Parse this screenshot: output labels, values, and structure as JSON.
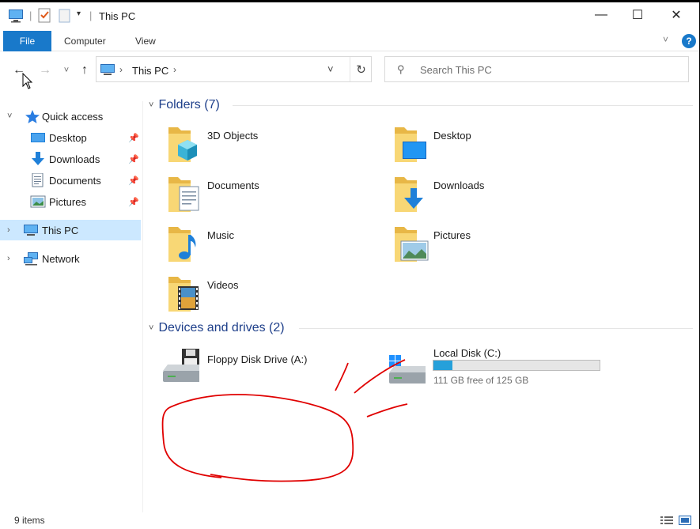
{
  "window": {
    "title": "This PC",
    "controls": {
      "minimize": "—",
      "maximize": "☐",
      "close": "✕"
    }
  },
  "ribbon": {
    "tabs": [
      "File",
      "Computer",
      "View"
    ],
    "help": "?"
  },
  "navigation": {
    "back": "←",
    "forward": "→",
    "recent": "˅",
    "up": "↑"
  },
  "address_bar": {
    "path": "This PC",
    "separator": "›",
    "dropdown": "˅",
    "refresh": "↻"
  },
  "search": {
    "placeholder": "Search This PC",
    "icon": "search-icon"
  },
  "sidebar": {
    "quick_access": {
      "label": "Quick access"
    },
    "quick_items": [
      {
        "label": "Desktop",
        "icon": "desktop-icon"
      },
      {
        "label": "Downloads",
        "icon": "downloads-icon"
      },
      {
        "label": "Documents",
        "icon": "documents-icon"
      },
      {
        "label": "Pictures",
        "icon": "pictures-icon"
      }
    ],
    "this_pc": {
      "label": "This PC"
    },
    "network": {
      "label": "Network"
    }
  },
  "content": {
    "folders_header": "Folders (7)",
    "folders": [
      {
        "name": "3D Objects",
        "icon": "3d-objects-folder-icon"
      },
      {
        "name": "Desktop",
        "icon": "desktop-folder-icon"
      },
      {
        "name": "Documents",
        "icon": "documents-folder-icon"
      },
      {
        "name": "Downloads",
        "icon": "downloads-folder-icon"
      },
      {
        "name": "Music",
        "icon": "music-folder-icon"
      },
      {
        "name": "Pictures",
        "icon": "pictures-folder-icon"
      },
      {
        "name": "Videos",
        "icon": "videos-folder-icon"
      }
    ],
    "drives_header": "Devices and drives (2)",
    "drives": [
      {
        "name": "Floppy Disk Drive (A:)",
        "icon": "floppy-drive-icon"
      },
      {
        "name": "Local Disk (C:)",
        "icon": "local-disk-icon",
        "free_text": "111 GB free of 125 GB",
        "used_fraction": 0.112
      }
    ]
  },
  "status": {
    "item_count": "9 items"
  },
  "colors": {
    "accent": "#1979ca",
    "selected": "#cce8ff",
    "group_title": "#1e3f8a",
    "folder": "#f8d775",
    "drive_bar": "#26a0da",
    "annotation": "#e00000"
  }
}
